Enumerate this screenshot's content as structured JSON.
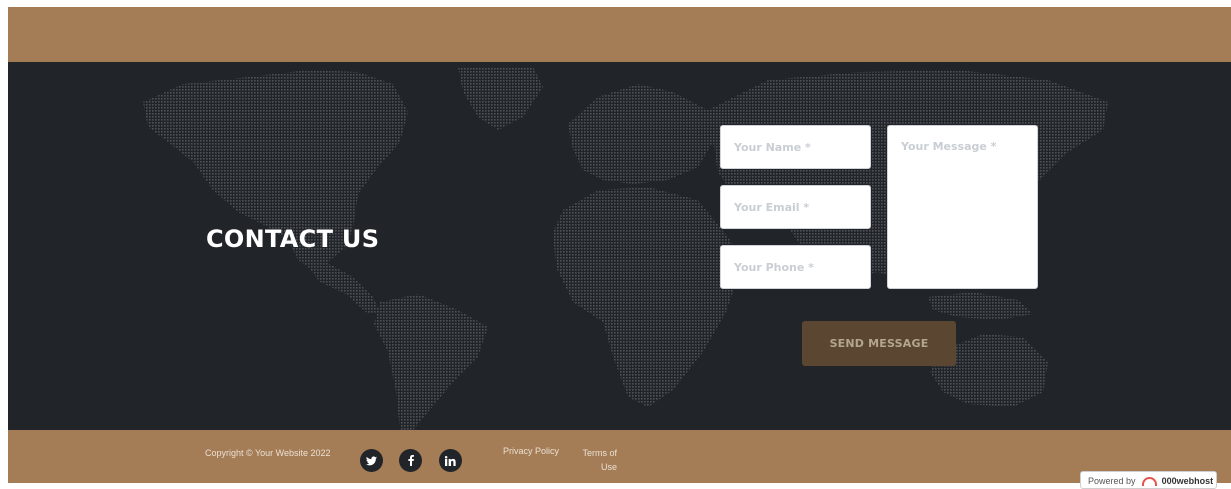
{
  "contact": {
    "title": "CONTACT US",
    "name_placeholder": "Your Name *",
    "email_placeholder": "Your Email *",
    "phone_placeholder": "Your Phone *",
    "message_placeholder": "Your Message *",
    "send_label": "SEND MESSAGE"
  },
  "footer": {
    "copyright": "Copyright © Your Website 2022",
    "social": [
      "twitter-icon",
      "facebook-icon",
      "linkedin-icon"
    ],
    "privacy_label": "Privacy Policy",
    "terms_label": "Terms of Use"
  },
  "badge": {
    "powered_prefix": "Powered by",
    "brand": "000webhost"
  },
  "colors": {
    "brand_brown": "#a47d57",
    "dark_bg": "#212529",
    "button_bg": "#5b4731"
  }
}
